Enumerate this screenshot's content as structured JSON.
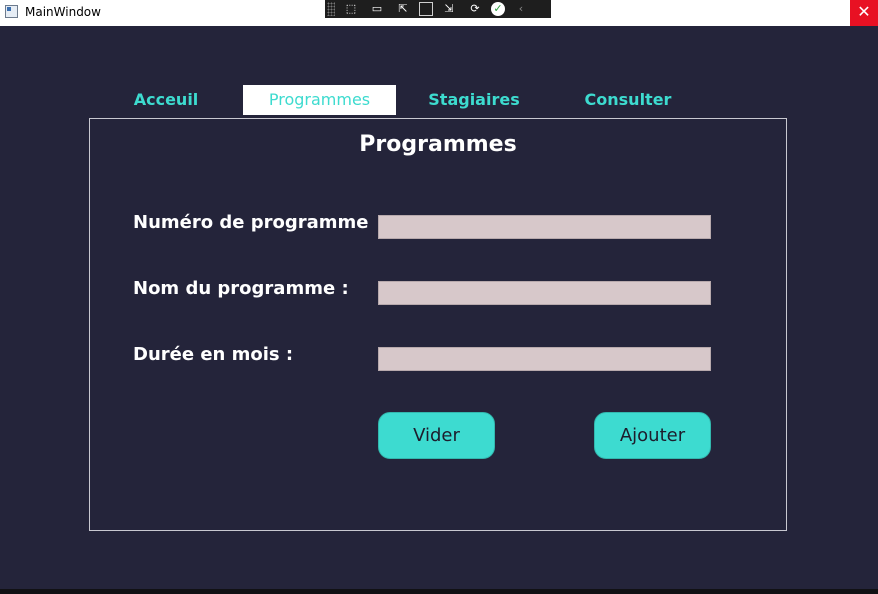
{
  "window": {
    "title": "MainWindow",
    "close_glyph": "✕"
  },
  "debug_toolbar": {
    "tools": [
      "live-visual-tree-icon",
      "record-icon",
      "select-element-icon",
      "layout-adorners-icon",
      "track-focus-icon",
      "hot-reload-icon",
      "binding-check-icon",
      "collapse-icon"
    ]
  },
  "tabs": [
    {
      "label": "Acceuil",
      "active": false
    },
    {
      "label": "Programmes",
      "active": true
    },
    {
      "label": "Stagiaires",
      "active": false
    },
    {
      "label": "Consulter",
      "active": false
    }
  ],
  "form": {
    "title": "Programmes",
    "fields": [
      {
        "label": "Numéro de programme",
        "value": ""
      },
      {
        "label": "Nom du programme :",
        "value": ""
      },
      {
        "label": "Durée en mois :",
        "value": ""
      }
    ],
    "clear_label": "Vider",
    "add_label": "Ajouter"
  },
  "colors": {
    "background": "#24243a",
    "accent": "#3ddbcf",
    "field": "#d7c8ca",
    "close": "#e81123"
  }
}
